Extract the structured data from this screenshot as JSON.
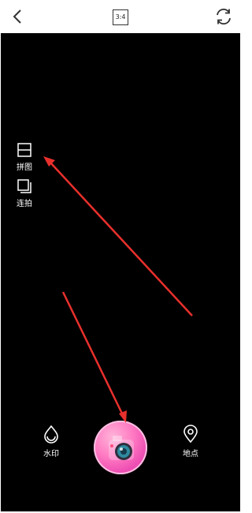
{
  "header": {
    "ratio_label": "3:4"
  },
  "side_tools": {
    "collage_label": "拼图",
    "burst_label": "连拍"
  },
  "bottom_bar": {
    "watermark_label": "水印",
    "location_label": "地点"
  },
  "icons": {
    "back": "back-arrow-icon",
    "flip": "flip-camera-icon",
    "collage": "collage-icon",
    "burst": "burst-icon",
    "watermark": "watermark-drop-icon",
    "location": "location-pin-icon",
    "shutter": "camera-shutter-icon"
  },
  "colors": {
    "viewfinder": "#000000",
    "annotation_arrow": "#e8302c",
    "shutter_pink": "#ee4fb3"
  }
}
